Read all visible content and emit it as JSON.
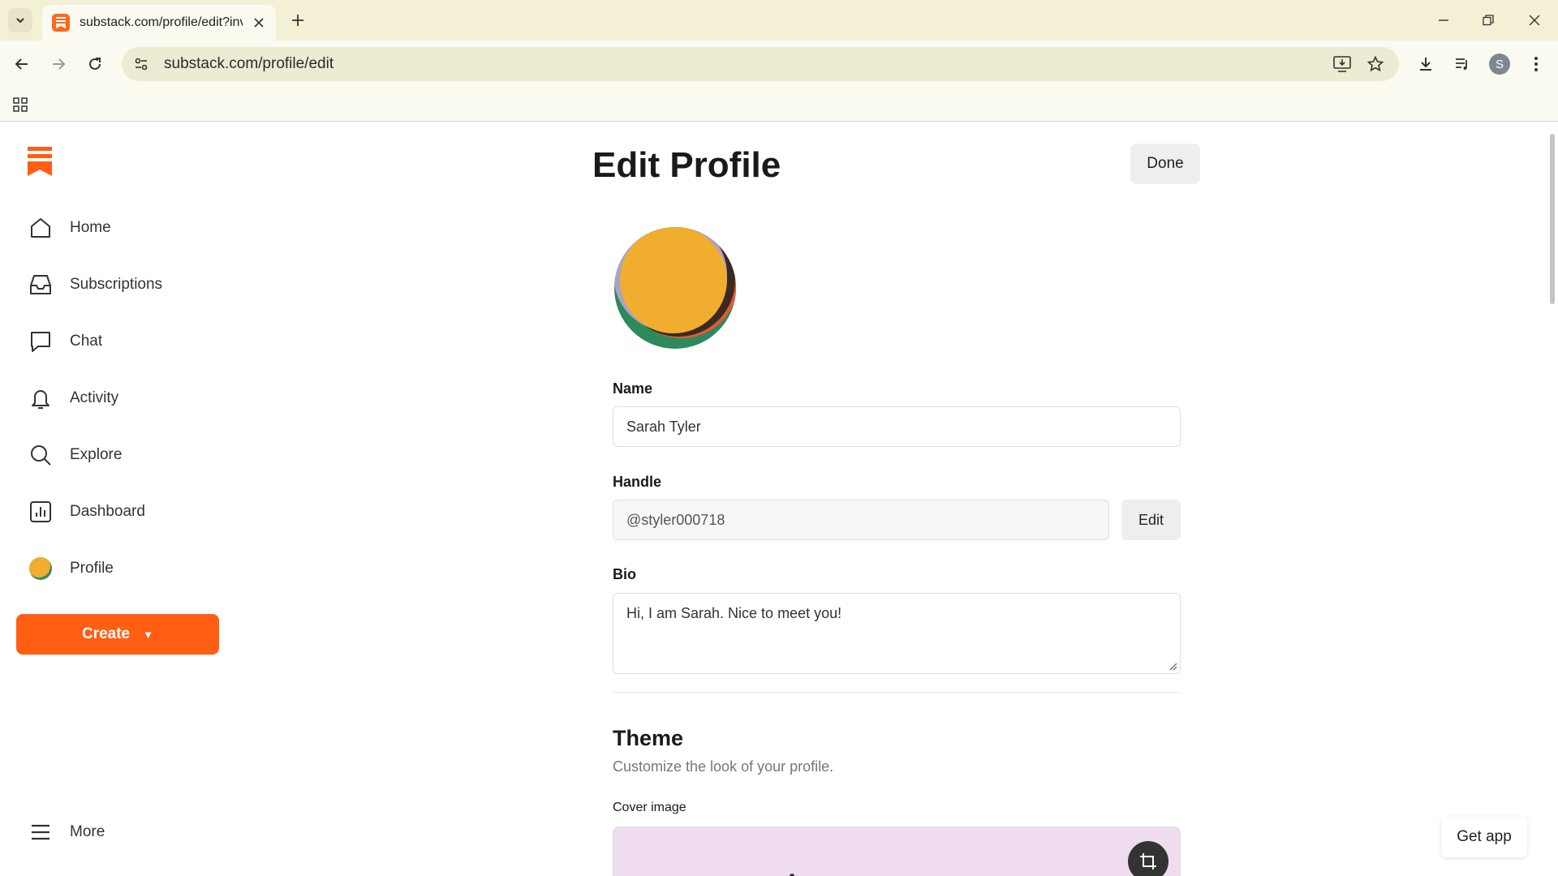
{
  "browser": {
    "tab_title": "substack.com/profile/edit?invite",
    "url": "substack.com/profile/edit",
    "profile_initial": "S"
  },
  "sidebar": {
    "items": [
      {
        "label": "Home",
        "icon": "home-icon"
      },
      {
        "label": "Subscriptions",
        "icon": "inbox-icon"
      },
      {
        "label": "Chat",
        "icon": "chat-icon"
      },
      {
        "label": "Activity",
        "icon": "bell-icon"
      },
      {
        "label": "Explore",
        "icon": "search-icon"
      },
      {
        "label": "Dashboard",
        "icon": "chart-icon"
      },
      {
        "label": "Profile",
        "icon": "avatar"
      }
    ],
    "create_label": "Create",
    "more_label": "More"
  },
  "main": {
    "title": "Edit Profile",
    "done_label": "Done",
    "name_label": "Name",
    "name_value": "Sarah Tyler",
    "handle_label": "Handle",
    "handle_value": "@styler000718",
    "handle_edit_label": "Edit",
    "bio_label": "Bio",
    "bio_value": "Hi, I am Sarah. Nice to meet you!",
    "theme_title": "Theme",
    "theme_subtitle": "Customize the look of your profile.",
    "cover_label": "Cover image"
  },
  "get_app_label": "Get app",
  "colors": {
    "brand": "#ff5e13",
    "browser_frame": "#f3f0d6",
    "cover_bg": "#efdcef"
  }
}
